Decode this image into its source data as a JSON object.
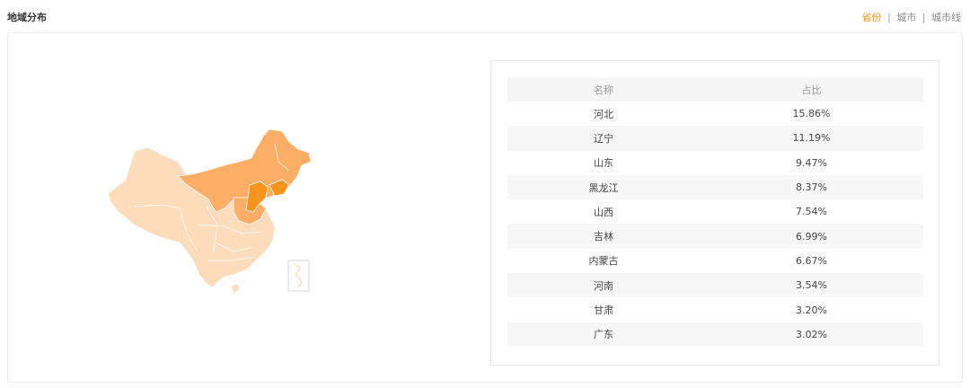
{
  "header": {
    "title": "地域分布",
    "tabs": [
      {
        "label": "省份",
        "active": true
      },
      {
        "label": "城市",
        "active": false
      },
      {
        "label": "城市线",
        "active": false
      }
    ],
    "separator": "|"
  },
  "colors": {
    "accent": "#f7941d",
    "map_light": "#fddcbc",
    "map_mid": "#fcae66",
    "map_dark": "#f7941d"
  },
  "table": {
    "headers": {
      "name": "名称",
      "share": "占比"
    },
    "rows": [
      {
        "name": "河北",
        "share": "15.86%"
      },
      {
        "name": "辽宁",
        "share": "11.19%"
      },
      {
        "name": "山东",
        "share": "9.47%"
      },
      {
        "name": "黑龙江",
        "share": "8.37%"
      },
      {
        "name": "山西",
        "share": "7.54%"
      },
      {
        "name": "吉林",
        "share": "6.99%"
      },
      {
        "name": "内蒙古",
        "share": "6.67%"
      },
      {
        "name": "河南",
        "share": "3.54%"
      },
      {
        "name": "甘肃",
        "share": "3.20%"
      },
      {
        "name": "广东",
        "share": "3.02%"
      }
    ]
  }
}
